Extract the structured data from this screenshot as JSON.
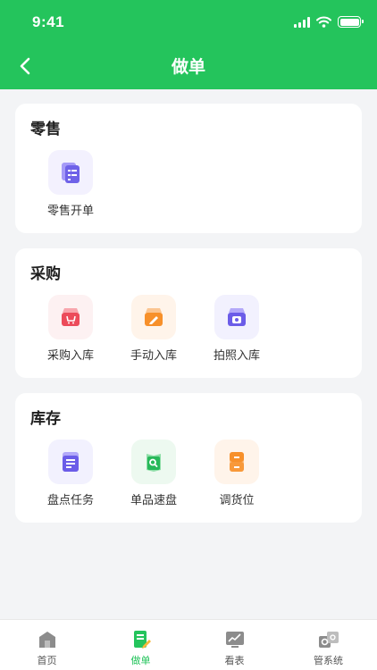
{
  "status_bar": {
    "time": "9:41"
  },
  "nav": {
    "title": "做单"
  },
  "colors": {
    "primary": "#24c45c",
    "background": "#f3f4f6"
  },
  "sections": [
    {
      "title": "零售",
      "items": [
        {
          "label": "零售开单",
          "icon": "retail-order-icon"
        }
      ]
    },
    {
      "title": "采购",
      "items": [
        {
          "label": "采购入库",
          "icon": "purchase-stockin-icon"
        },
        {
          "label": "手动入库",
          "icon": "manual-stockin-icon"
        },
        {
          "label": "拍照入库",
          "icon": "photo-stockin-icon"
        }
      ]
    },
    {
      "title": "库存",
      "items": [
        {
          "label": "盘点任务",
          "icon": "stocktake-task-icon"
        },
        {
          "label": "单品速盘",
          "icon": "quick-count-icon"
        },
        {
          "label": "调货位",
          "icon": "relocate-icon"
        }
      ]
    }
  ],
  "tabbar": {
    "active": "做单",
    "items": [
      {
        "label": "首页",
        "icon": "home-icon"
      },
      {
        "label": "做单",
        "icon": "order-icon"
      },
      {
        "label": "看表",
        "icon": "chart-icon"
      },
      {
        "label": "管系统",
        "icon": "settings-icon"
      }
    ]
  }
}
